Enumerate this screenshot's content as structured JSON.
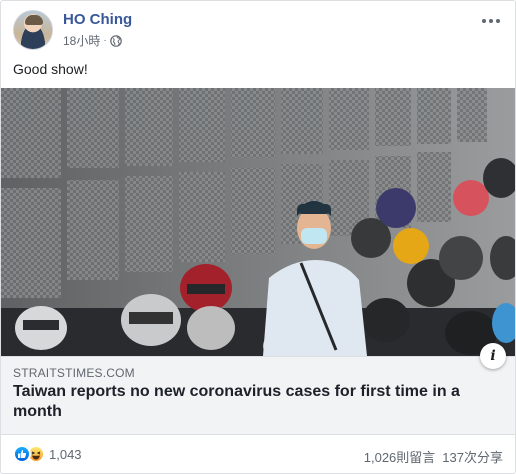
{
  "post": {
    "author": "HO Ching",
    "time": "18小時",
    "separator": "·",
    "privacy_icon": "globe-icon",
    "text": "Good show!"
  },
  "link": {
    "domain": "STRAITSTIMES.COM",
    "title": "Taiwan reports no new coronavirus cases for first time in a month",
    "info_label": "i"
  },
  "footer": {
    "reaction_icons": [
      "like-icon",
      "haha-icon"
    ],
    "reaction_count": "1,043",
    "comments": "1,026則留言",
    "shares": "137次分享"
  },
  "colors": {
    "name": "#385898",
    "muted": "#606770",
    "link_bg": "#f2f3f5",
    "like_blue": "#1877f2"
  }
}
